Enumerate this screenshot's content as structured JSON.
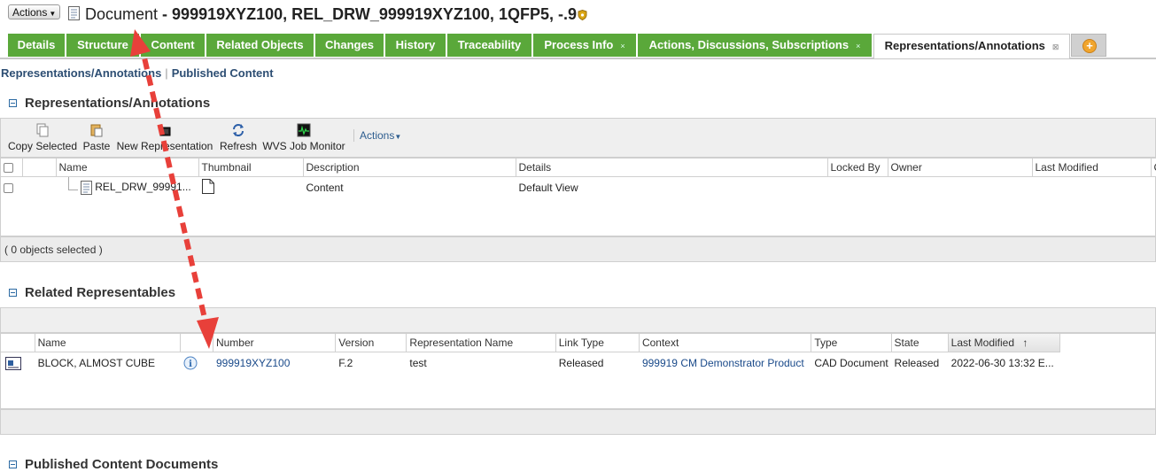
{
  "header": {
    "actions_label": "Actions",
    "title_prefix": "Document",
    "title_main": " - 999919XYZ100, REL_DRW_999919XYZ100, 1QFP5, -.9"
  },
  "tabs": [
    {
      "label": "Details"
    },
    {
      "label": "Structure"
    },
    {
      "label": "Content"
    },
    {
      "label": "Related Objects"
    },
    {
      "label": "Changes"
    },
    {
      "label": "History"
    },
    {
      "label": "Traceability"
    },
    {
      "label": "Process Info",
      "close": "×"
    },
    {
      "label": "Actions, Discussions, Subscriptions",
      "close": "×"
    },
    {
      "label": "Representations/Annotations",
      "close": "⊠",
      "active": true
    }
  ],
  "subnav": {
    "item1": "Representations/Annotations",
    "item2": "Published Content"
  },
  "section1": {
    "title": "Representations/Annotations",
    "toolbar": {
      "copy": "Copy Selected",
      "paste": "Paste",
      "new_rep": "New Representation",
      "refresh": "Refresh",
      "wvs": "WVS Job Monitor",
      "actions": "Actions"
    },
    "columns": [
      "Name",
      "Thumbnail",
      "Description",
      "Details",
      "Locked By",
      "Owner",
      "Last Modified",
      "C"
    ],
    "rows": [
      {
        "name": "REL_DRW_99991...",
        "description": "Content",
        "details": "Default View"
      }
    ],
    "status": "( 0 objects selected )"
  },
  "section2": {
    "title": "Related Representables",
    "columns": [
      "Name",
      "Number",
      "Version",
      "Representation Name",
      "Link Type",
      "Context",
      "Type",
      "State",
      "Last Modified"
    ],
    "sort_indicator": "↑",
    "rows": [
      {
        "name": "BLOCK, ALMOST CUBE",
        "number": "999919XYZ100",
        "version": "F.2",
        "rep_name": "test",
        "link_type": "Released",
        "context": "999919 CM Demonstrator Product",
        "type": "CAD Document",
        "state": "Released",
        "last_modified": "2022-06-30 13:32 E..."
      }
    ]
  },
  "section3": {
    "title": "Published Content Documents"
  },
  "colors": {
    "tab_green": "#5aa83a",
    "link_blue": "#1a4a8a",
    "arrow_red": "#e8403a"
  }
}
